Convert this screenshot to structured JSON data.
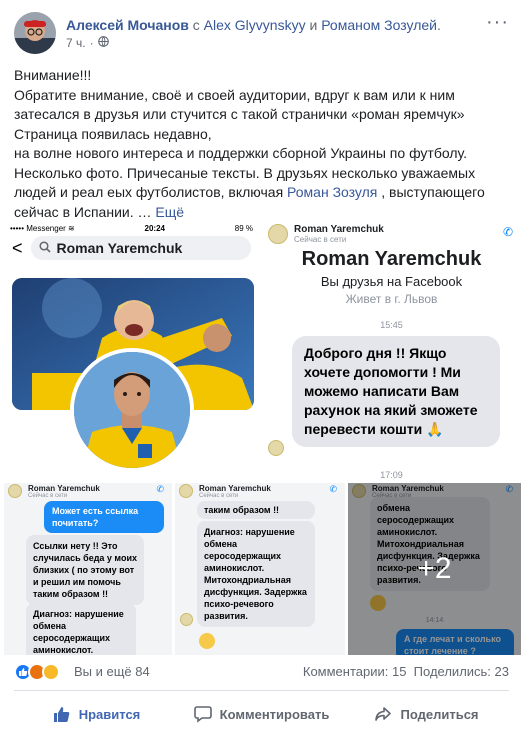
{
  "header": {
    "author": "Алексей Мочанов",
    "with_word": "с",
    "with_person1": "Alex Glyvynskyy",
    "and_word": "и",
    "with_person2": "Романом Зозулей",
    "period": ".",
    "time": "7 ч.",
    "separator": "·",
    "privacy_icon": "globe-icon",
    "more_icon": "more-dots-icon"
  },
  "post": {
    "lines": [
      "Внимание!!!",
      "Обратите внимание, своё и своей аудитории, вдруг к вам или к ним",
      "затесался в друзья или стучится с такой странички «роман яремчук»",
      "Страница появилась недавно,",
      "на волне нового интереса и поддержки сборной Украины по футболу.",
      "Несколько фото. Причесаные тексты. В друзьях несколько уважаемых",
      "людей и реал еых футболистов, включая"
    ],
    "tag": "Роман Зозуля",
    "after_tag": " , выступающего",
    "last_line": "сейчас в Испании. …",
    "more": "Ещё"
  },
  "photos": {
    "p1": {
      "carrier": "••••• Messenger",
      "wifi": "≋",
      "clock": "20:24",
      "battery": "89 %",
      "back": "<",
      "search_query": "Roman Yaremchuk"
    },
    "p2": {
      "chat_name": "Roman Yaremchuk",
      "chat_status": "Сейчас в сети",
      "profile_name": "Roman Yaremchuk",
      "friends_line": "Вы друзья на Facebook",
      "lives_line": "Живет в г. Львов",
      "time1": "15:45",
      "message": "Доброго дня !! Якщо хочете допомогти ! Ми можемо написати Вам рахунок на який зможете перевести кошти 🙏",
      "time2": "17:09"
    },
    "p3": {
      "chat_name": "Roman Yaremchuk",
      "chat_status": "Сейчас в сети",
      "msg_blue": "Может есть ссылка почитать?",
      "msg1": "Ссылки нету !! Это случилась беда у моих близких ( по этому вот и решил им помочь таким образом !!",
      "msg2": "Диагноз: нарушение обмена серосодержащих аминокислот."
    },
    "p4": {
      "chat_name": "Roman Yaremchuk",
      "chat_status": "Сейчас в сети",
      "msg0": "таким образом !!",
      "msg1": "Диагноз: нарушение обмена серосодержащих аминокислот. Митохондриальная дисфункция. Задержка психо-речевого развития."
    },
    "p5": {
      "chat_name": "Roman Yaremchuk",
      "chat_status": "Сейчас в сети",
      "msg1": "обмена серосодержащих аминокислот. Митохондриальная дисфункция. Задержка психо-речевого развития.",
      "time": "14:14",
      "msg_blue": "А где лечат и сколько стоит лечение ?",
      "overlay": "+2"
    }
  },
  "reactions": {
    "summary": "Вы и ещё 84",
    "comments": "Комментарии: 15",
    "shares": "Поделились: 23"
  },
  "actions": {
    "like": "Нравится",
    "comment": "Комментировать",
    "share": "Поделиться"
  },
  "colors": {
    "link": "#385898",
    "like_blue": "#4267b2",
    "messenger_blue": "#1b8cf5",
    "bubble_grey": "#e4e6eb"
  }
}
